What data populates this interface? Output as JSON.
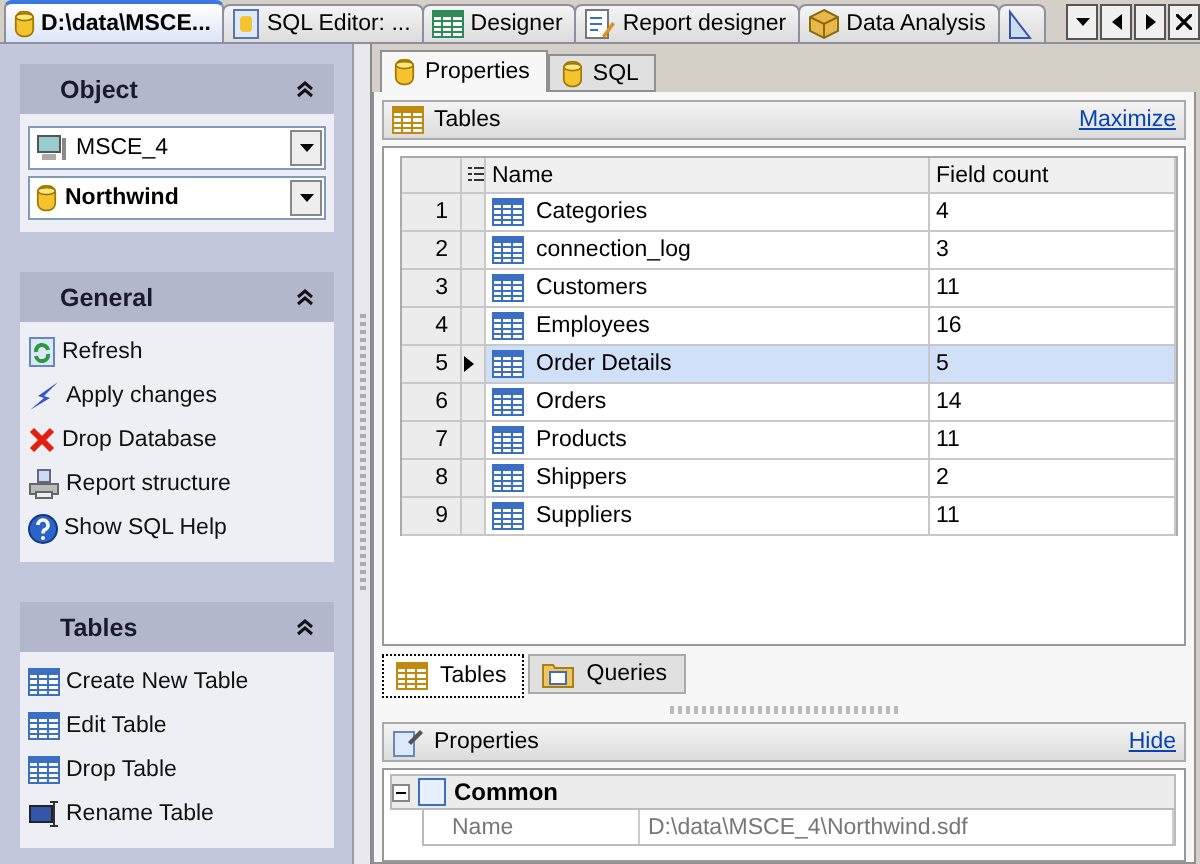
{
  "doc_tabs": [
    {
      "label": "D:\\data\\MSCE...",
      "selected": true
    },
    {
      "label": "SQL Editor: ...",
      "selected": false
    },
    {
      "label": "Designer",
      "selected": false
    },
    {
      "label": "Report designer",
      "selected": false
    },
    {
      "label": "Data Analysis",
      "selected": false
    },
    {
      "selected": false
    }
  ],
  "sidebar": {
    "object": {
      "title": "Object",
      "server": "MSCE_4",
      "database": "Northwind"
    },
    "general": {
      "title": "General",
      "items": [
        {
          "label": "Refresh"
        },
        {
          "label": "Apply changes"
        },
        {
          "label": "Drop Database"
        },
        {
          "label": "Report structure"
        },
        {
          "label": "Show SQL Help"
        }
      ]
    },
    "tables": {
      "title": "Tables",
      "items": [
        {
          "label": "Create New Table"
        },
        {
          "label": "Edit Table"
        },
        {
          "label": "Drop Table"
        },
        {
          "label": "Rename Table"
        }
      ]
    }
  },
  "inner_tabs": [
    {
      "label": "Properties",
      "selected": true
    },
    {
      "label": "SQL",
      "selected": false
    }
  ],
  "tables_panel": {
    "title": "Tables",
    "action": "Maximize",
    "columns": [
      "Name",
      "Field count"
    ],
    "rows": [
      {
        "num": "1",
        "name": "Categories",
        "count": "4",
        "selected": false
      },
      {
        "num": "2",
        "name": "connection_log",
        "count": "3",
        "selected": false
      },
      {
        "num": "3",
        "name": "Customers",
        "count": "11",
        "selected": false
      },
      {
        "num": "4",
        "name": "Employees",
        "count": "16",
        "selected": false
      },
      {
        "num": "5",
        "name": "Order Details",
        "count": "5",
        "selected": true
      },
      {
        "num": "6",
        "name": "Orders",
        "count": "14",
        "selected": false
      },
      {
        "num": "7",
        "name": "Products",
        "count": "11",
        "selected": false
      },
      {
        "num": "8",
        "name": "Shippers",
        "count": "2",
        "selected": false
      },
      {
        "num": "9",
        "name": "Suppliers",
        "count": "11",
        "selected": false
      }
    ]
  },
  "bottom_tabs": [
    {
      "label": "Tables",
      "selected": true
    },
    {
      "label": "Queries",
      "selected": false
    }
  ],
  "properties_panel": {
    "title": "Properties",
    "action": "Hide",
    "group": {
      "title": "Common",
      "expanded": true,
      "rows": [
        {
          "name": "Name",
          "value": "D:\\data\\MSCE_4\\Northwind.sdf"
        }
      ]
    }
  }
}
